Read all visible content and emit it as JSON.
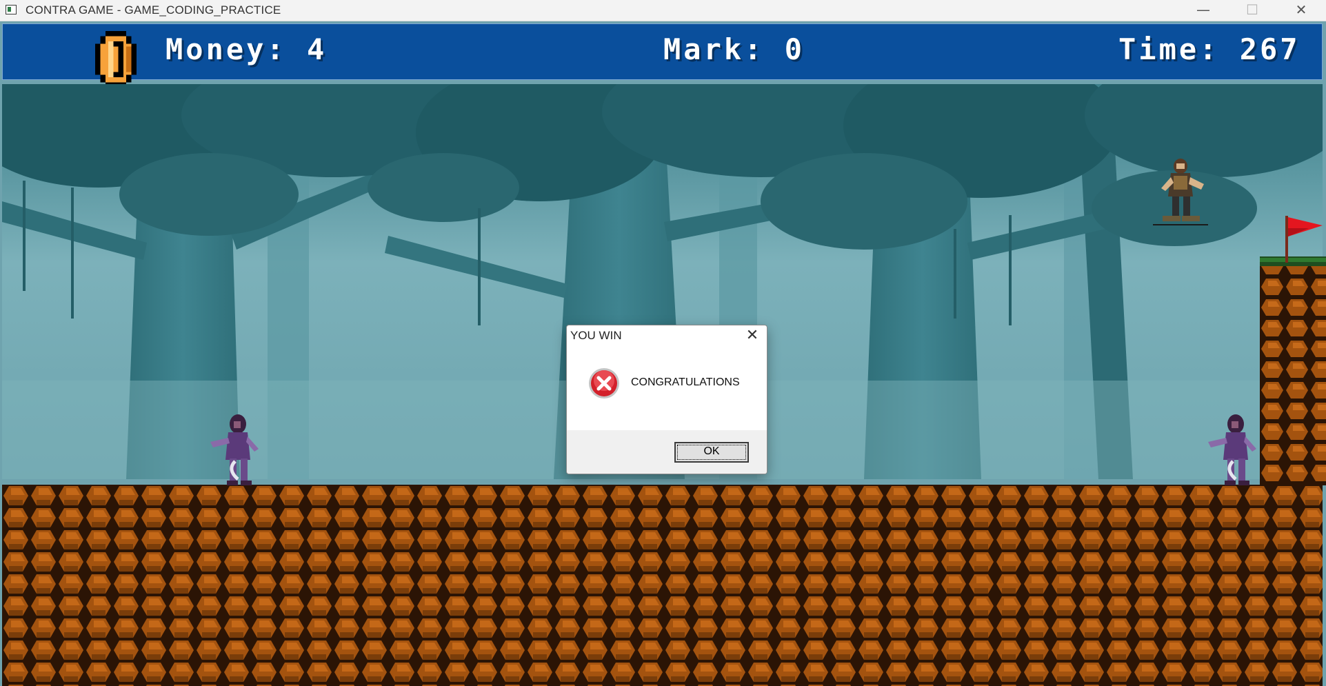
{
  "window": {
    "title": "CONTRA GAME - GAME_CODING_PRACTICE",
    "minimize_glyph": "—",
    "maximize_glyph": "☐",
    "close_glyph": "✕"
  },
  "hud": {
    "money_text": "Money: 4",
    "mark_text": "Mark: 0",
    "time_text": "Time: 267",
    "coin_icon": "coin-icon",
    "background_color": "#0a4f9c"
  },
  "dialog": {
    "title": "YOU WIN",
    "close_glyph": "✕",
    "icon": "error-icon",
    "message": "CONGRATULATIONS",
    "ok_label": "OK"
  },
  "scene": {
    "sky_color": "#6fa3ae",
    "ground_color": "#a0510f",
    "flag_color": "#e4161f",
    "sprites": [
      "player-soldier",
      "enemy-zombie-left",
      "enemy-zombie-right",
      "goal-flag"
    ]
  }
}
